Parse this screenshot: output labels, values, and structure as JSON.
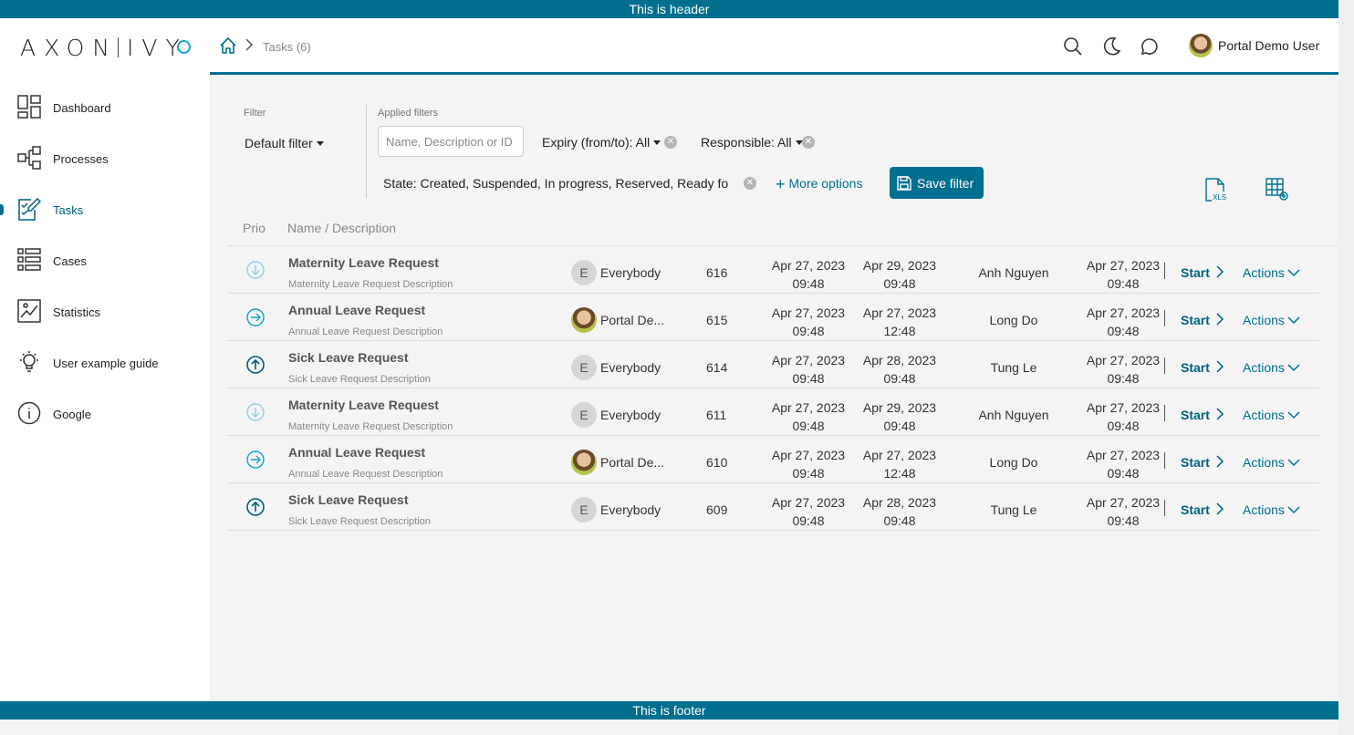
{
  "banners": {
    "header": "This is header",
    "footer": "This is footer"
  },
  "app": {
    "logo": "AXON",
    "logo_suffix": "IVY"
  },
  "sidebar": {
    "items": [
      {
        "label": "Dashboard",
        "icon": "dashboard-icon"
      },
      {
        "label": "Processes",
        "icon": "processes-icon"
      },
      {
        "label": "Tasks",
        "icon": "tasks-icon",
        "active": true
      },
      {
        "label": "Cases",
        "icon": "cases-icon"
      },
      {
        "label": "Statistics",
        "icon": "statistics-icon"
      },
      {
        "label": "User example guide",
        "icon": "lightbulb-icon"
      },
      {
        "label": "Google",
        "icon": "info-icon"
      }
    ]
  },
  "topbar": {
    "breadcrumb": "Tasks (6)",
    "user_name": "Portal Demo User"
  },
  "filters": {
    "filter_label": "Filter",
    "default_filter": "Default filter",
    "applied_label": "Applied filters",
    "search_placeholder": "Name, Description or ID",
    "expiry": "Expiry (from/to): All",
    "responsible": "Responsible: All",
    "state": "State: Created, Suspended, In progress, Reserved, Ready for jo",
    "more_options": "More options",
    "save_filter": "Save filter"
  },
  "table": {
    "headers": {
      "prio": "Prio",
      "name": "Name / Description"
    },
    "rows": [
      {
        "prio": "low",
        "name": "Maternity Leave Request",
        "desc": "Maternity Leave Request Description",
        "resp_initial": "E",
        "resp_photo": false,
        "responsible": "Everybody",
        "id": "616",
        "created_date": "Apr 27, 2023",
        "created_time": "09:48",
        "expiry_date": "Apr 29, 2023",
        "expiry_time": "09:48",
        "assignee": "Anh Nguyen",
        "modified_date": "Apr 27, 2023",
        "modified_time": "09:48",
        "start": "Start",
        "actions": "Actions"
      },
      {
        "prio": "normal",
        "name": "Annual Leave Request",
        "desc": "Annual Leave Request Description",
        "resp_initial": "",
        "resp_photo": true,
        "responsible": "Portal De...",
        "id": "615",
        "created_date": "Apr 27, 2023",
        "created_time": "09:48",
        "expiry_date": "Apr 27, 2023",
        "expiry_time": "12:48",
        "assignee": "Long Do",
        "modified_date": "Apr 27, 2023",
        "modified_time": "09:48",
        "start": "Start",
        "actions": "Actions"
      },
      {
        "prio": "high",
        "name": "Sick Leave Request",
        "desc": "Sick Leave Request Description",
        "resp_initial": "E",
        "resp_photo": false,
        "responsible": "Everybody",
        "id": "614",
        "created_date": "Apr 27, 2023",
        "created_time": "09:48",
        "expiry_date": "Apr 28, 2023",
        "expiry_time": "09:48",
        "assignee": "Tung Le",
        "modified_date": "Apr 27, 2023",
        "modified_time": "09:48",
        "start": "Start",
        "actions": "Actions"
      },
      {
        "prio": "low",
        "name": "Maternity Leave Request",
        "desc": "Maternity Leave Request Description",
        "resp_initial": "E",
        "resp_photo": false,
        "responsible": "Everybody",
        "id": "611",
        "created_date": "Apr 27, 2023",
        "created_time": "09:48",
        "expiry_date": "Apr 29, 2023",
        "expiry_time": "09:48",
        "assignee": "Anh Nguyen",
        "modified_date": "Apr 27, 2023",
        "modified_time": "09:48",
        "start": "Start",
        "actions": "Actions"
      },
      {
        "prio": "normal",
        "name": "Annual Leave Request",
        "desc": "Annual Leave Request Description",
        "resp_initial": "",
        "resp_photo": true,
        "responsible": "Portal De...",
        "id": "610",
        "created_date": "Apr 27, 2023",
        "created_time": "09:48",
        "expiry_date": "Apr 27, 2023",
        "expiry_time": "12:48",
        "assignee": "Long Do",
        "modified_date": "Apr 27, 2023",
        "modified_time": "09:48",
        "start": "Start",
        "actions": "Actions"
      },
      {
        "prio": "high",
        "name": "Sick Leave Request",
        "desc": "Sick Leave Request Description",
        "resp_initial": "E",
        "resp_photo": false,
        "responsible": "Everybody",
        "id": "609",
        "created_date": "Apr 27, 2023",
        "created_time": "09:48",
        "expiry_date": "Apr 28, 2023",
        "expiry_time": "09:48",
        "assignee": "Tung Le",
        "modified_date": "Apr 27, 2023",
        "modified_time": "09:48",
        "start": "Start",
        "actions": "Actions"
      }
    ]
  },
  "colors": {
    "primary": "#006f8f",
    "accent": "#13a3c7",
    "prio_low": "#8fd0e3"
  }
}
